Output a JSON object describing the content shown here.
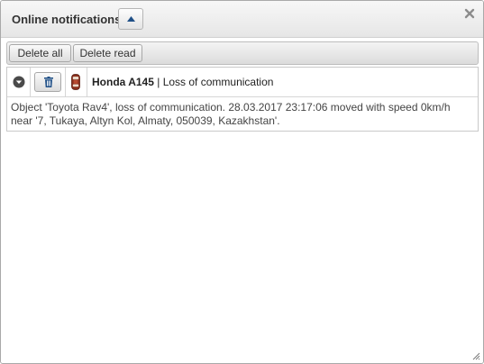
{
  "window": {
    "title": "Online notifications"
  },
  "toolbar": {
    "delete_all_label": "Delete all",
    "delete_read_label": "Delete read"
  },
  "notifications": [
    {
      "object_name": "Honda A145",
      "separator": " | ",
      "notification_name": "Loss of communication",
      "object_icon": "car-icon",
      "message": "Object 'Toyota Rav4', loss of communication. 28.03.2017 23:17:06 moved with speed 0km/h near '7, Tukaya, Altyn Kol, Almaty, 050039, Kazakhstan'."
    }
  ],
  "icons": {
    "collapse": "caret-up-icon",
    "close": "close-icon",
    "expand": "chevron-down-circle-icon",
    "delete": "trash-icon",
    "resize": "resize-grip-icon"
  },
  "colors": {
    "window_border": "#a9a9a9",
    "titlebar": "#ececec",
    "text": "#333333",
    "icon_blue": "#1f4f87"
  }
}
